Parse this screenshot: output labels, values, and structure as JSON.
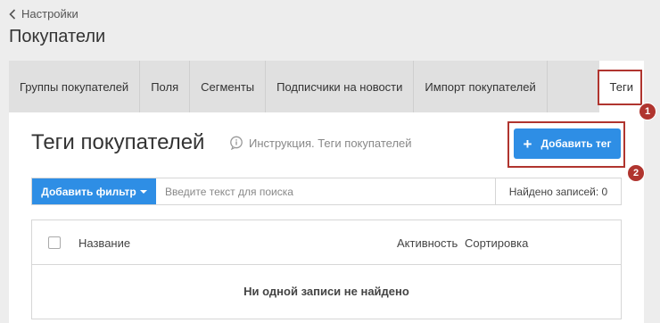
{
  "breadcrumb": {
    "back_label": "Настройки"
  },
  "page": {
    "title": "Покупатели"
  },
  "tabs": [
    {
      "label": "Группы покупателей"
    },
    {
      "label": "Поля"
    },
    {
      "label": "Сегменты"
    },
    {
      "label": "Подписчики на новости"
    },
    {
      "label": "Импорт покупателей"
    },
    {
      "label": "Теги",
      "active": true
    }
  ],
  "section": {
    "title": "Теги покупателей",
    "help_text": "Инструкция. Теги покупателей",
    "add_button": "Добавить тег"
  },
  "filter": {
    "add_filter_label": "Добавить фильтр",
    "search_placeholder": "Введите текст для поиска",
    "found_text": "Найдено записей: 0"
  },
  "table": {
    "columns": [
      "Название",
      "Активность",
      "Сортировка"
    ],
    "empty_text": "Ни одной записи не найдено"
  },
  "annotations": [
    {
      "number": "1"
    },
    {
      "number": "2"
    }
  ],
  "colors": {
    "accent": "#2e8ee5",
    "annotation": "#b0352f"
  }
}
